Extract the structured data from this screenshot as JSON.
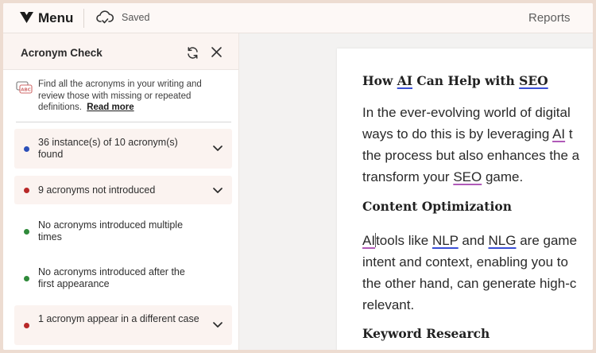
{
  "topbar": {
    "menu_label": "Menu",
    "saved_label": "Saved",
    "reports_label": "Reports"
  },
  "panel": {
    "title": "Acronym Check",
    "description": "Find all the acronyms in your writing and review those with missing or repeated definitions.",
    "read_more": "Read more",
    "items": [
      {
        "text": "36 instance(s) of 10 acronym(s) found",
        "dot_color": "#2b4fb8",
        "expandable": true
      },
      {
        "text": "9 acronyms not introduced",
        "dot_color": "#b82828",
        "expandable": true
      },
      {
        "text": "No acronyms introduced multiple times",
        "dot_color": "#2f8a3a",
        "expandable": false
      },
      {
        "text": "No acronyms introduced after the first appearance",
        "dot_color": "#2f8a3a",
        "expandable": false
      },
      {
        "text": "1 acronym appear in a different case",
        "dot_color": "#b82828",
        "expandable": true
      }
    ]
  },
  "document": {
    "heading1": {
      "pre": "How ",
      "ac1": "AI",
      "mid": " Can Help with ",
      "ac2": "SEO"
    },
    "para1": {
      "line1": "In the ever-evolving world of digital",
      "line2_pre": "ways to do this is by leveraging ",
      "line2_ac": "AI",
      "line2_post": " t",
      "line3": "the process but also enhances the a",
      "line4_pre": "transform your ",
      "line4_ac": "SEO",
      "line4_post": " game."
    },
    "heading2": "Content Optimization",
    "para2": {
      "line1_ac1": "AI",
      "line1_mid1": "tools like ",
      "line1_ac2": "NLP",
      "line1_mid2": " and ",
      "line1_ac3": "NLG",
      "line1_post": " are game",
      "line2": "intent and context, enabling you to",
      "line3": "the other hand, can generate high-c",
      "line4": "relevant."
    },
    "heading3": "Keyword Research"
  },
  "colors": {
    "acronym_underline_blue": "#3a4fd6",
    "acronym_underline_purple": "#b05ab8",
    "background_frame": "#eddcd1"
  }
}
